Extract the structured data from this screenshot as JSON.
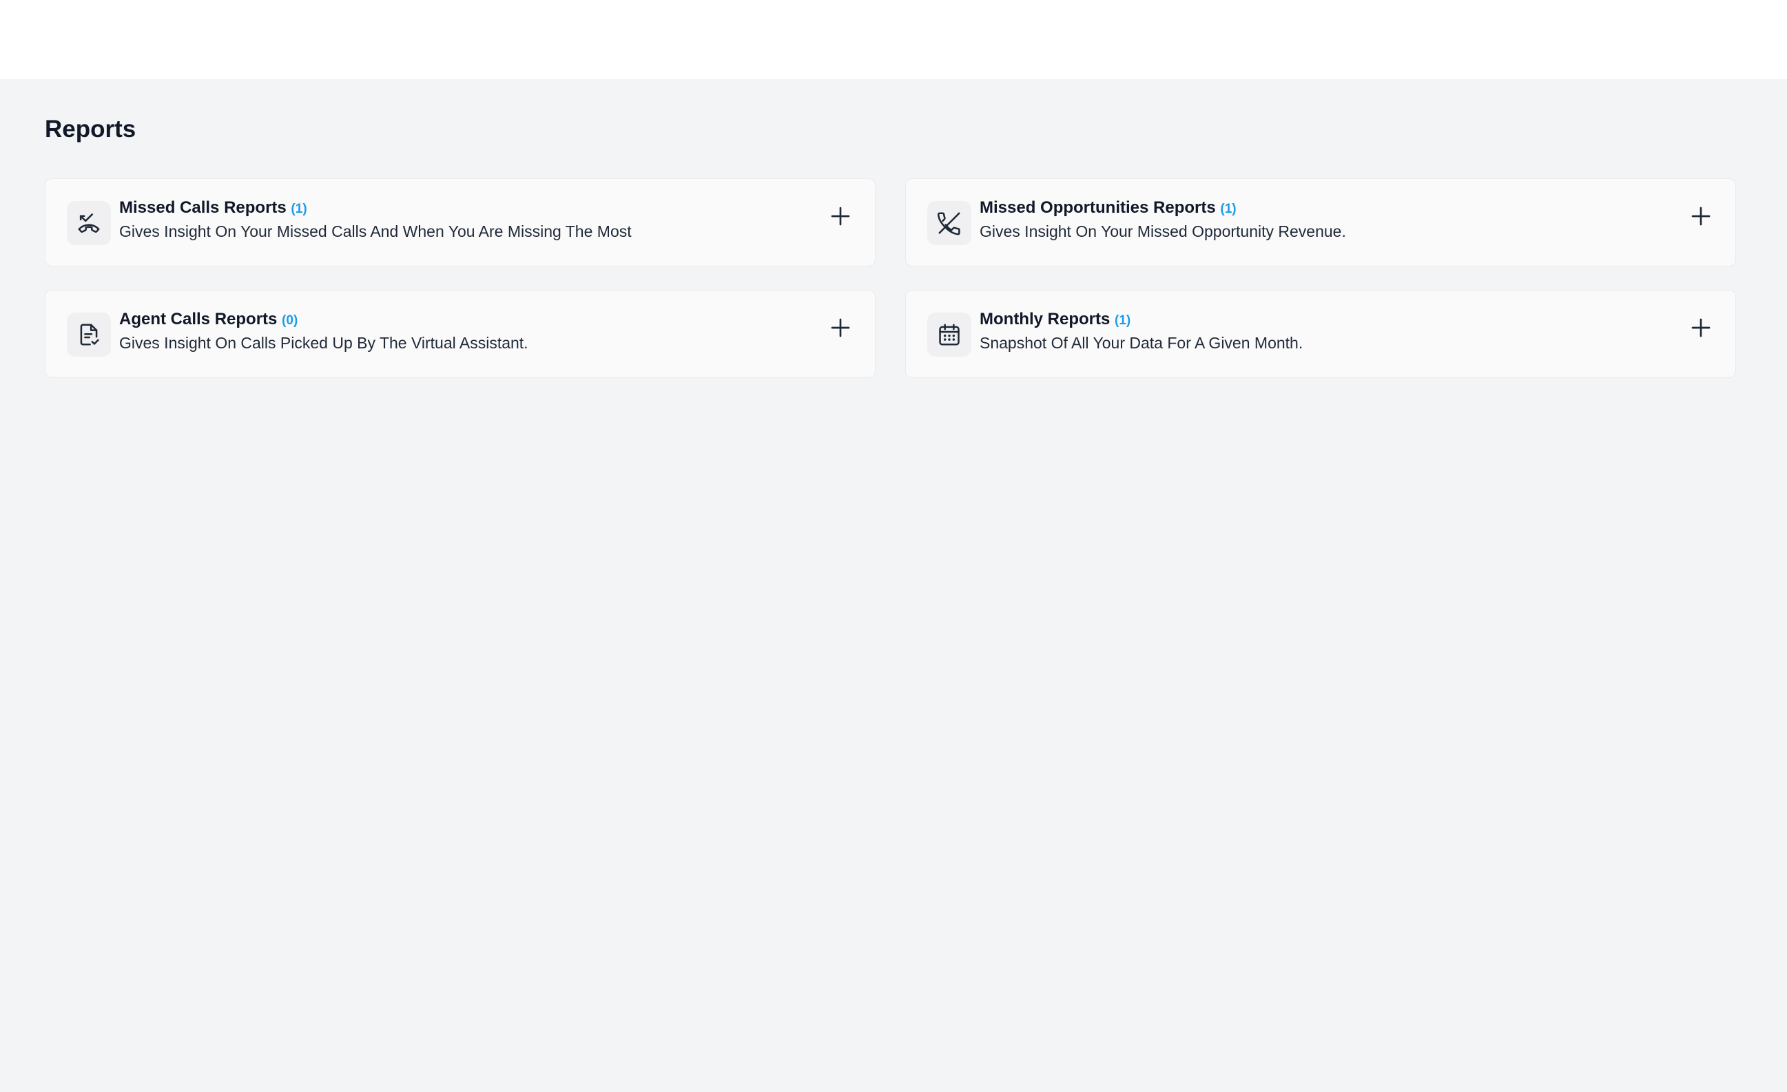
{
  "page": {
    "title": "Reports"
  },
  "reports": [
    {
      "title": "Missed Calls Reports",
      "count": "(1)",
      "description": "Gives Insight On Your Missed Calls And When You Are Missing The Most",
      "icon": "missed-call-icon"
    },
    {
      "title": "Missed Opportunities Reports",
      "count": "(1)",
      "description": "Gives Insight On Your Missed Opportunity Revenue.",
      "icon": "phone-off-icon"
    },
    {
      "title": "Agent Calls Reports",
      "count": "(0)",
      "description": "Gives Insight On Calls Picked Up By The Virtual Assistant.",
      "icon": "document-check-icon"
    },
    {
      "title": "Monthly Reports",
      "count": "(1)",
      "description": "Snapshot Of All Your Data For A Given Month.",
      "icon": "calendar-icon"
    }
  ],
  "colors": {
    "accent": "#1a9ce8",
    "background": "#f3f4f6",
    "card": "#fafafa"
  }
}
